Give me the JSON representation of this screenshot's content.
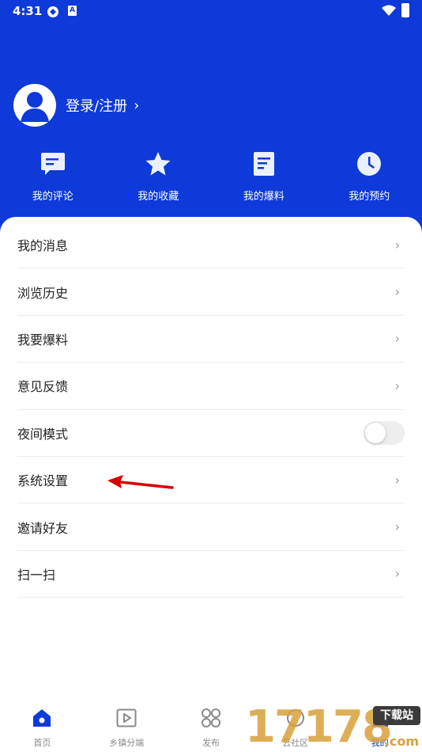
{
  "status_bar": {
    "time": "4:31",
    "notif_icon": "A"
  },
  "profile": {
    "login_label": "登录/注册",
    "chevron": "›"
  },
  "quick_actions": [
    {
      "label": "我的评论",
      "icon": "comment-icon"
    },
    {
      "label": "我的收藏",
      "icon": "star-icon"
    },
    {
      "label": "我的爆料",
      "icon": "document-icon"
    },
    {
      "label": "我的预约",
      "icon": "clock-icon"
    }
  ],
  "menu": [
    {
      "label": "我的消息",
      "type": "link",
      "chevron": "›"
    },
    {
      "label": "浏览历史",
      "type": "link",
      "chevron": "›"
    },
    {
      "label": "我要爆料",
      "type": "link",
      "chevron": "›"
    },
    {
      "label": "意见反馈",
      "type": "link",
      "chevron": "›"
    },
    {
      "label": "夜间模式",
      "type": "toggle",
      "enabled": false
    },
    {
      "label": "系统设置",
      "type": "link",
      "chevron": "›"
    },
    {
      "label": "邀请好友",
      "type": "link",
      "chevron": "›"
    },
    {
      "label": "扫一扫",
      "type": "link",
      "chevron": "›"
    }
  ],
  "bottom_nav": [
    {
      "label": "首页",
      "icon": "home-icon",
      "active": false
    },
    {
      "label": "乡镇分端",
      "icon": "play-icon",
      "active": false
    },
    {
      "label": "发布",
      "icon": "apps-icon",
      "active": false
    },
    {
      "label": "云社区",
      "icon": "community-icon",
      "active": false
    },
    {
      "label": "我的",
      "icon": "profile-icon",
      "active": true
    }
  ],
  "watermark": {
    "digits": "17178",
    "badge": "下载站",
    "suffix": ".com"
  },
  "colors": {
    "primary": "#0d3ad8",
    "annotation": "#d40000",
    "watermark": "#d9a13a"
  }
}
